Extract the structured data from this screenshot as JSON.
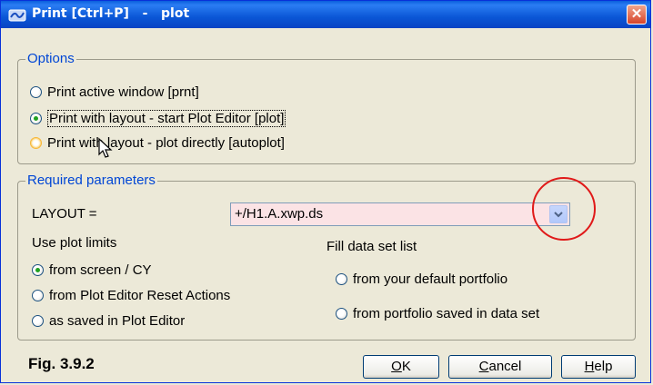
{
  "window": {
    "title": "Print [Ctrl+P]   -   plot",
    "close_glyph": "✕"
  },
  "options": {
    "legend": "Options",
    "items": [
      {
        "label": "Print active window [prnt]",
        "selected": false
      },
      {
        "label": "Print with layout - start Plot Editor [plot]",
        "selected": true
      },
      {
        "label": "Print with layout - plot directly [autoplot]",
        "selected": false,
        "hover": true
      }
    ]
  },
  "required": {
    "legend": "Required parameters",
    "layout_label": "LAYOUT =",
    "layout_value": "+/H1.A.xwp.ds",
    "plot_limits": {
      "heading": "Use plot limits",
      "items": [
        {
          "label": "from screen / CY",
          "selected": true
        },
        {
          "label": "from Plot Editor Reset Actions",
          "selected": false
        },
        {
          "label": "as saved in Plot Editor",
          "selected": false
        }
      ]
    },
    "fill_list": {
      "heading": "Fill data set list",
      "items": [
        {
          "label": "from your default portfolio",
          "selected": false
        },
        {
          "label": "from portfolio saved in data set",
          "selected": false
        }
      ]
    }
  },
  "footer": {
    "figure_label": "Fig. 3.9.2",
    "buttons": {
      "ok": {
        "mnemonic": "O",
        "rest": "K"
      },
      "cancel": {
        "mnemonic": "C",
        "rest": "ancel"
      },
      "help": {
        "mnemonic": "H",
        "rest": "elp"
      }
    }
  },
  "colors": {
    "accent": "#0046d5",
    "selected_dot": "#21a121",
    "layout_field_bg": "#fbe3e5",
    "annotation_circle": "#e01919"
  }
}
